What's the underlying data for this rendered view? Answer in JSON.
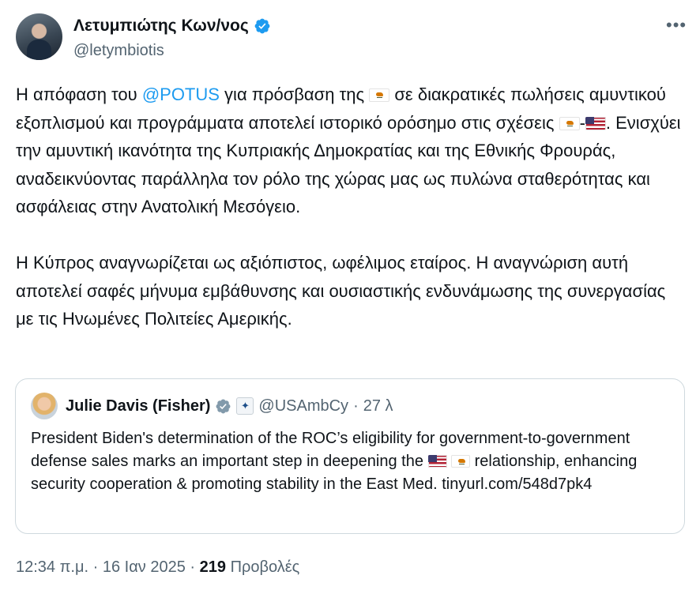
{
  "author": {
    "name": "Λετυμπιώτης Κων/νος",
    "handle": "@letymbiotis",
    "verified": true
  },
  "more_button": "•••",
  "tweet": {
    "p1_a": "Η απόφαση του ",
    "mention": "@POTUS",
    "p1_b": " για πρόσβαση της ",
    "p1_c": " σε διακρατικές πωλήσεις αμυντικού εξοπλισμού  και προγράμματα αποτελεί ιστορικό ορόσημο στις σχέσεις ",
    "p1_dash": "-",
    "p1_d": ". Ενισχύει την αμυντική ικανότητα της Κυπριακής Δημοκρατίας και της Εθνικής Φρουράς, αναδεικνύοντας παράλληλα τον ρόλο της χώρας μας ως πυλώνα σταθερότητας και ασφάλειας στην Ανατολική Μεσόγειο.",
    "p2": "Η Κύπρος αναγνωρίζεται ως αξιόπιστος, ωφέλιμος εταίρος.  Η αναγνώριση αυτή αποτελεί σαφές μήνυμα εμβάθυνσης και ουσιαστικής ενδυνάμωσης της συνεργασίας με τις Ηνωμένες Πολιτείες Αμερικής."
  },
  "quoted": {
    "name": "Julie Davis (Fisher)",
    "verified": true,
    "handle": "@USAmbCy",
    "separator": "·",
    "time": "27 λ",
    "text_a": "President Biden's determination of the ROC’s eligibility for government-to-government defense sales marks an important step in deepening the ",
    "text_b": " relationship, enhancing security cooperation & promoting stability in the East Med.  tinyurl.com/548d7pk4"
  },
  "meta": {
    "time": "12:34 π.μ.",
    "sep1": "·",
    "date": "16 Ιαν 2025",
    "sep2": "·",
    "views_count": "219",
    "views_label": "Προβολές"
  },
  "colors": {
    "accent": "#1d9bf0",
    "text": "#0f1419",
    "muted": "#536471",
    "border": "#cfd9de",
    "verified_gray": "#829aab"
  }
}
